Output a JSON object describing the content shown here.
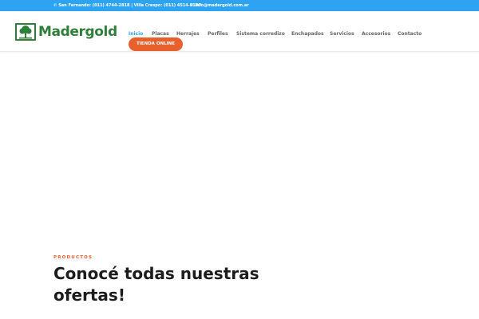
{
  "topbar": {
    "phone_text": "San Fernando: (011) 4744-2818 | Villa Crespo: (011) 4514-9100",
    "email_text": "info@madergold.com.ar",
    "phone_icon": "phone-icon",
    "email_icon": "mail-icon"
  },
  "logo": {
    "text": "Madergold",
    "icon": "tree-icon",
    "brand_color": "#2f7f3a"
  },
  "nav": {
    "items": [
      {
        "label": "Inicio",
        "active": true
      },
      {
        "label": "Placas"
      },
      {
        "label": "Herrajes"
      },
      {
        "label": "Perfiles"
      },
      {
        "label": "Sistema corredizo"
      },
      {
        "label": "Enchapados"
      },
      {
        "label": "Servicios"
      },
      {
        "label": "Accesorios"
      },
      {
        "label": "Contacto"
      }
    ],
    "cta_label": "TIENDA ONLINE"
  },
  "hero": {
    "eyebrow": "PRODUCTOS",
    "headline": "Conocé todas nuestras ofertas!"
  },
  "colors": {
    "accent": "#2ea3f2",
    "cta": "#e8602c",
    "text": "#666666"
  }
}
